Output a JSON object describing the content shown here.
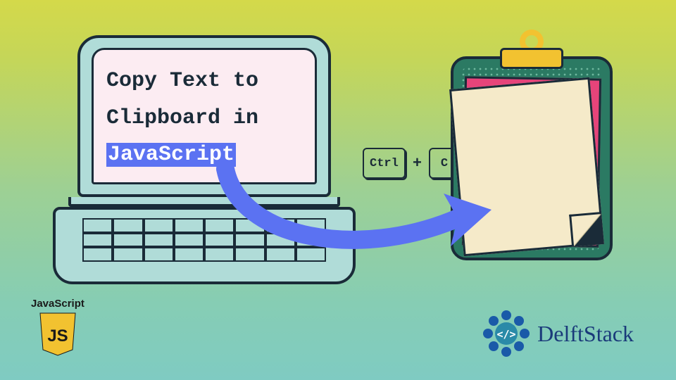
{
  "screen": {
    "line1": "Copy Text to",
    "line2": "Clipboard in",
    "highlighted": "JavaScript"
  },
  "shortcut": {
    "key1": "Ctrl",
    "plus": "+",
    "key2": "C"
  },
  "js_badge": {
    "label": "JavaScript",
    "glyph": "JS"
  },
  "brand": {
    "name": "DelftStack",
    "glyph": "</>"
  },
  "colors": {
    "accent_arrow": "#5b72f2",
    "laptop_body": "#b0dcd8",
    "outline": "#1a2b38",
    "screen_bg": "#fcecf2",
    "board": "#2b7a63",
    "clip": "#f2c230",
    "paper_pink": "#e6447a",
    "paper_cream": "#f5eac9",
    "js_yellow": "#f2c230",
    "brand_blue": "#1a3a7a"
  }
}
